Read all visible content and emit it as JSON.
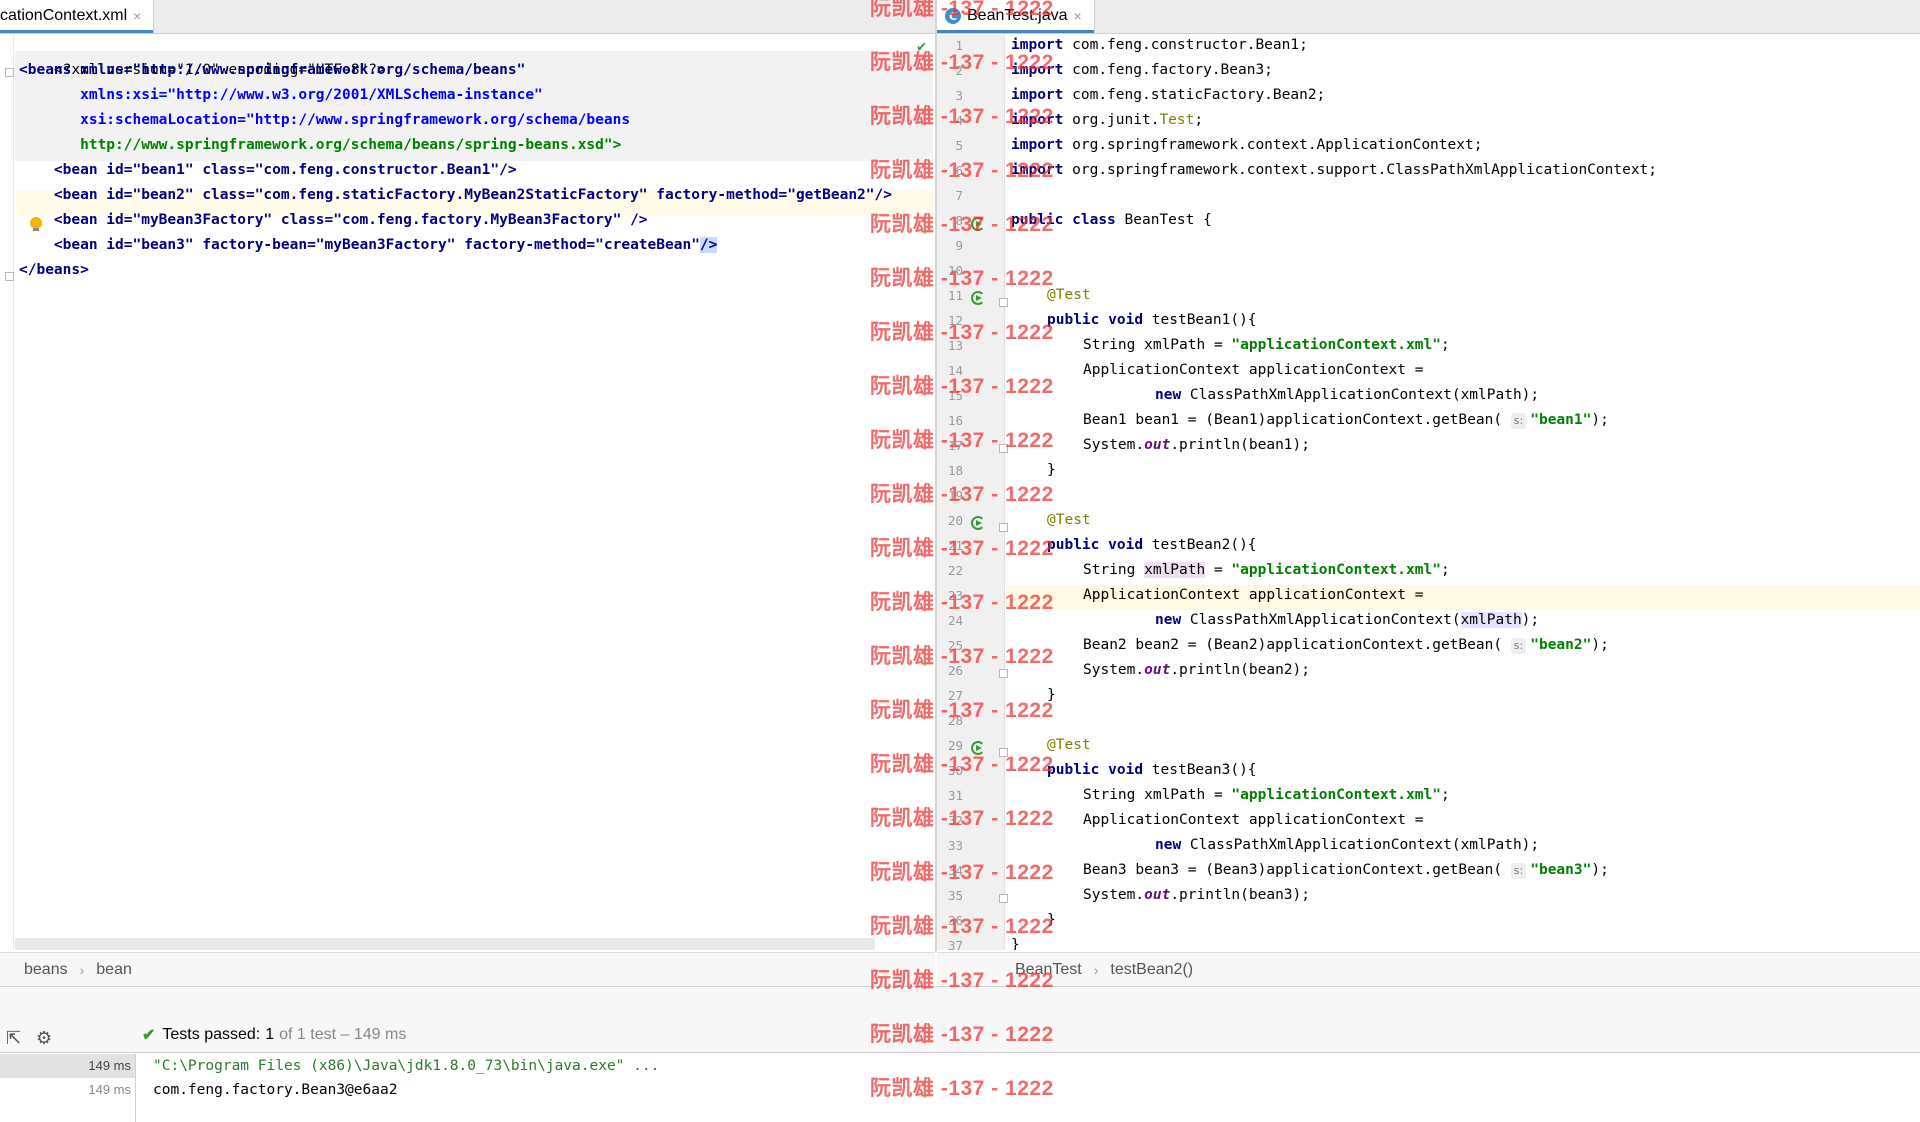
{
  "tabs": {
    "left": {
      "label": "plicationContext.xml",
      "close": "×"
    },
    "right": {
      "label": "BeanTest.java",
      "close": "×",
      "icon_letter": "C"
    }
  },
  "xml": {
    "lines": [
      "<?xml version=\"1.0\" encoding=\"UTF-8\"?>",
      "<beans xmlns=\"http://www.springframework.org/schema/beans\"",
      "       xmlns:xsi=\"http://www.w3.org/2001/XMLSchema-instance\"",
      "       xsi:schemaLocation=\"http://www.springframework.org/schema/beans",
      "       http://www.springframework.org/schema/beans/spring-beans.xsd\">",
      "    <bean id=\"bean1\" class=\"com.feng.constructor.Bean1\"/>",
      "    <bean id=\"bean2\" class=\"com.feng.staticFactory.MyBean2StaticFactory\" factory-method=\"getBean2\"/>",
      "    <bean id=\"myBean3Factory\" class=\"com.feng.factory.MyBean3Factory\" />",
      "    <bean id=\"bean3\" factory-bean=\"myBean3Factory\" factory-method=\"createBean\"/>",
      "</beans>"
    ]
  },
  "java": {
    "line_numbers": [
      "1",
      "2",
      "3",
      "4",
      "5",
      "6",
      "7",
      "8",
      "9",
      "10",
      "11",
      "12",
      "13",
      "14",
      "15",
      "16",
      "17",
      "18",
      "19",
      "20",
      "21",
      "22",
      "23",
      "24",
      "25",
      "26",
      "27",
      "28",
      "29",
      "30",
      "31",
      "32",
      "33",
      "34",
      "35",
      "36",
      "37"
    ],
    "imports": [
      "com.feng.constructor.Bean1;",
      "com.feng.factory.Bean3;",
      "com.feng.staticFactory.Bean2;",
      "org.junit.",
      "org.springframework.context.ApplicationContext;",
      "org.springframework.context.support.ClassPathXmlApplicationContext;"
    ],
    "import_test_word": "Test",
    "import_test_semicolon": ";",
    "kw": {
      "import": "import",
      "public": "public",
      "class": "class",
      "void": "void",
      "new": "new"
    },
    "class_decl": " BeanTest {",
    "annotation": "@Test",
    "methods": [
      {
        "name": " testBean1(){",
        "bean_type": "Bean1",
        "bean_var": "bean1",
        "cast": "(Bean1)",
        "key": "\"bean1\""
      },
      {
        "name": " testBean2(){",
        "bean_type": "Bean2",
        "bean_var": "bean2",
        "cast": "(Bean2)",
        "key": "\"bean2\""
      },
      {
        "name": " testBean3(){",
        "bean_type": "Bean3",
        "bean_var": "bean3",
        "cast": "(Bean3)",
        "key": "\"bean3\""
      }
    ],
    "string_decl": "String ",
    "xml_path_var": "xmlPath",
    "eq": " = ",
    "xml_path_value": "\"applicationContext.xml\"",
    "semicolon": ";",
    "ctx_decl": "ApplicationContext applicationContext =",
    "ctx_new": " ClassPathXmlApplicationContext(",
    "ctx_close": ");",
    "get_bean": "applicationContext.getBean( ",
    "param_hint": "s:",
    "sysout_a": "System.",
    "sysout_out": "out",
    "sysout_b": ".println(",
    "sysout_c": ");",
    "close_brace": "}"
  },
  "breadcrumbs": {
    "left": [
      "beans",
      "bean"
    ],
    "right": [
      "BeanTest",
      "testBean2()"
    ],
    "separator": "›"
  },
  "run": {
    "status_label": "Tests passed:",
    "status_count": "1",
    "status_detail": "of 1 test – 149 ms",
    "tree": [
      "149 ms",
      "149 ms"
    ],
    "console": [
      "\"C:\\Program Files (x86)\\Java\\jdk1.8.0_73\\bin\\java.exe\" ...",
      "com.feng.factory.Bean3@e6aa2"
    ]
  },
  "watermark": {
    "text": "阮凯雄 -137 - 1222"
  },
  "colors": {
    "accent": "#4083c9",
    "keyword": "#000080",
    "string": "#008000",
    "annotation": "#808000",
    "watermark": "#ee3333"
  }
}
